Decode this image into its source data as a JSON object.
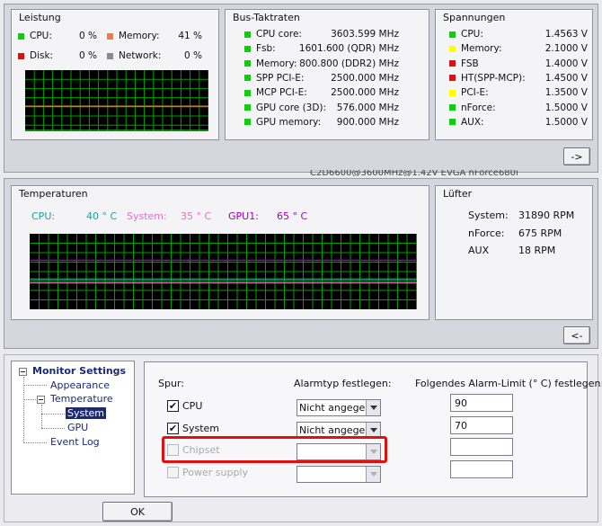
{
  "colors": {
    "green": "#11cc11",
    "orange": "#f07a40",
    "red": "#e01010",
    "gray": "#8a8a8a",
    "yellow": "#ffff00",
    "grid": "#00a000",
    "cpu_temp": "#1fa0a0",
    "system_temp": "#e070c8",
    "gpu_temp": "#9a00c0",
    "highlight": "#e31010"
  },
  "leistung": {
    "title": "Leistung",
    "items": [
      {
        "label": "CPU:",
        "value": "0 %",
        "color": "green"
      },
      {
        "label": "Memory:",
        "value": "41 %",
        "color": "orange"
      },
      {
        "label": "Disk:",
        "value": "0 %",
        "color": "red"
      },
      {
        "label": "Network:",
        "value": "0 %",
        "color": "gray"
      }
    ]
  },
  "bus": {
    "title": "Bus-Taktraten",
    "items": [
      {
        "label": "CPU core:",
        "value": "3603.599 MHz"
      },
      {
        "label": "Fsb:",
        "value": "1601.600 (QDR) MHz"
      },
      {
        "label": "Memory:",
        "value": "800.800 (DDR2) MHz"
      },
      {
        "label": "SPP PCI-E:",
        "value": "2500.000 MHz"
      },
      {
        "label": "MCP PCI-E:",
        "value": "2500.000 MHz"
      },
      {
        "label": "GPU core (3D):",
        "value": "576.000 MHz"
      },
      {
        "label": "GPU memory:",
        "value": "900.000 MHz"
      }
    ]
  },
  "spannungen": {
    "title": "Spannungen",
    "items": [
      {
        "label": "CPU:",
        "value": "1.4563 V",
        "color": "green"
      },
      {
        "label": "Memory:",
        "value": "2.1000 V",
        "color": "yellow"
      },
      {
        "label": "FSB",
        "value": "1.4000 V",
        "color": "red"
      },
      {
        "label": "HT(SPP-MCP):",
        "value": "1.4500 V",
        "color": "red"
      },
      {
        "label": "PCI-E:",
        "value": "1.3500 V",
        "color": "yellow"
      },
      {
        "label": "nForce:",
        "value": "1.5000 V",
        "color": "green"
      },
      {
        "label": "AUX:",
        "value": "1.5000 V",
        "color": "green"
      }
    ]
  },
  "expand_button": "->",
  "background_text": "C2D6600@3600MHz@1.42V    EVGA nForce680i",
  "temperaturen": {
    "title": "Temperaturen",
    "items": [
      {
        "label": "CPU:",
        "value": "40 ° C",
        "color": "cpu_temp"
      },
      {
        "label": "System:",
        "value": "35 ° C",
        "color": "system_temp"
      },
      {
        "label": "GPU1:",
        "value": "65 ° C",
        "color": "gpu_temp"
      }
    ]
  },
  "luefter": {
    "title": "Lüfter",
    "items": [
      {
        "label": "System:",
        "value": "31890 RPM"
      },
      {
        "label": "nForce:",
        "value": "675 RPM"
      },
      {
        "label": "AUX",
        "value": "18 RPM"
      }
    ]
  },
  "collapse_button": "<-",
  "tree": {
    "root": "Monitor Settings",
    "appearance": "Appearance",
    "temperature": "Temperature",
    "system": "System",
    "gpu": "GPU",
    "event_log": "Event Log"
  },
  "settings": {
    "col_spur": "Spur:",
    "col_alarmtyp": "Alarmtyp festlegen:",
    "col_limit": "Folgendes Alarm-Limit (° C) festlegen:",
    "rows": [
      {
        "label": "CPU",
        "checked": true,
        "enabled": true,
        "alarm_type": "Nicht angegeben",
        "limit": "90"
      },
      {
        "label": "System",
        "checked": true,
        "enabled": true,
        "alarm_type": "Nicht angegeben",
        "limit": "70"
      },
      {
        "label": "Chipset",
        "checked": false,
        "enabled": false,
        "alarm_type": "",
        "limit": ""
      },
      {
        "label": "Power supply",
        "checked": false,
        "enabled": false,
        "alarm_type": "",
        "limit": ""
      }
    ]
  },
  "ok_button": "OK"
}
